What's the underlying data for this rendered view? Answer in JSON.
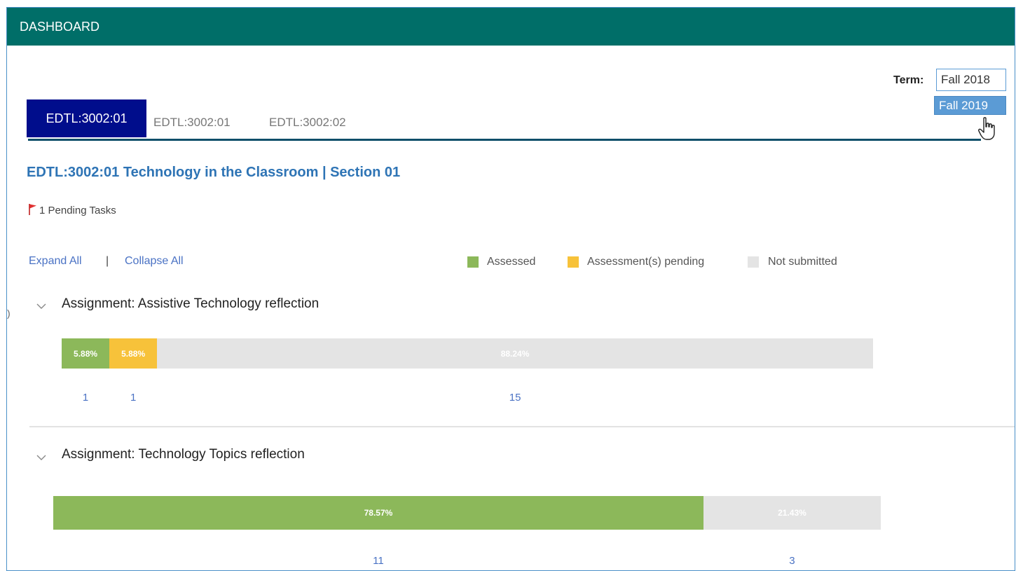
{
  "header": {
    "title": "DASHBOARD"
  },
  "term": {
    "label": "Term:",
    "selected": "Fall 2018",
    "hover_option": "Fall 2019"
  },
  "tabs": [
    {
      "label": "EDTL:3002:01",
      "active": true
    },
    {
      "label": "EDTL:3002:01",
      "active": false
    },
    {
      "label": "EDTL:3002:02",
      "active": false
    }
  ],
  "course": {
    "title": "EDTL:3002:01 Technology in the Classroom | Section 01",
    "pending_tasks": "1 Pending Tasks"
  },
  "controls": {
    "expand_all": "Expand All",
    "separator": "|",
    "collapse_all": "Collapse All"
  },
  "legend": [
    {
      "label": "Assessed",
      "color": "#8cb85a"
    },
    {
      "label": "Assessment(s) pending",
      "color": "#f7c23a"
    },
    {
      "label": "Not submitted",
      "color": "#e4e4e4"
    }
  ],
  "assignments": [
    {
      "title": "Assignment: Assistive Technology reflection",
      "segments": [
        {
          "status": "assessed",
          "percent": 5.88,
          "label": "5.88%",
          "count": "1"
        },
        {
          "status": "pending",
          "percent": 5.88,
          "label": "5.88%",
          "count": "1"
        },
        {
          "status": "not_submitted",
          "percent": 88.24,
          "label": "88.24%",
          "count": "15"
        }
      ]
    },
    {
      "title": "Assignment: Technology Topics reflection",
      "segments": [
        {
          "status": "assessed",
          "percent": 78.57,
          "label": "78.57%",
          "count": "11"
        },
        {
          "status": "not_submitted",
          "percent": 21.43,
          "label": "21.43%",
          "count": "3"
        }
      ]
    }
  ],
  "colors": {
    "header": "#006e68",
    "active_tab": "#000d8c",
    "title_blue": "#2e74b5",
    "link_blue": "#4a72c4",
    "flag_red": "#e03030"
  }
}
